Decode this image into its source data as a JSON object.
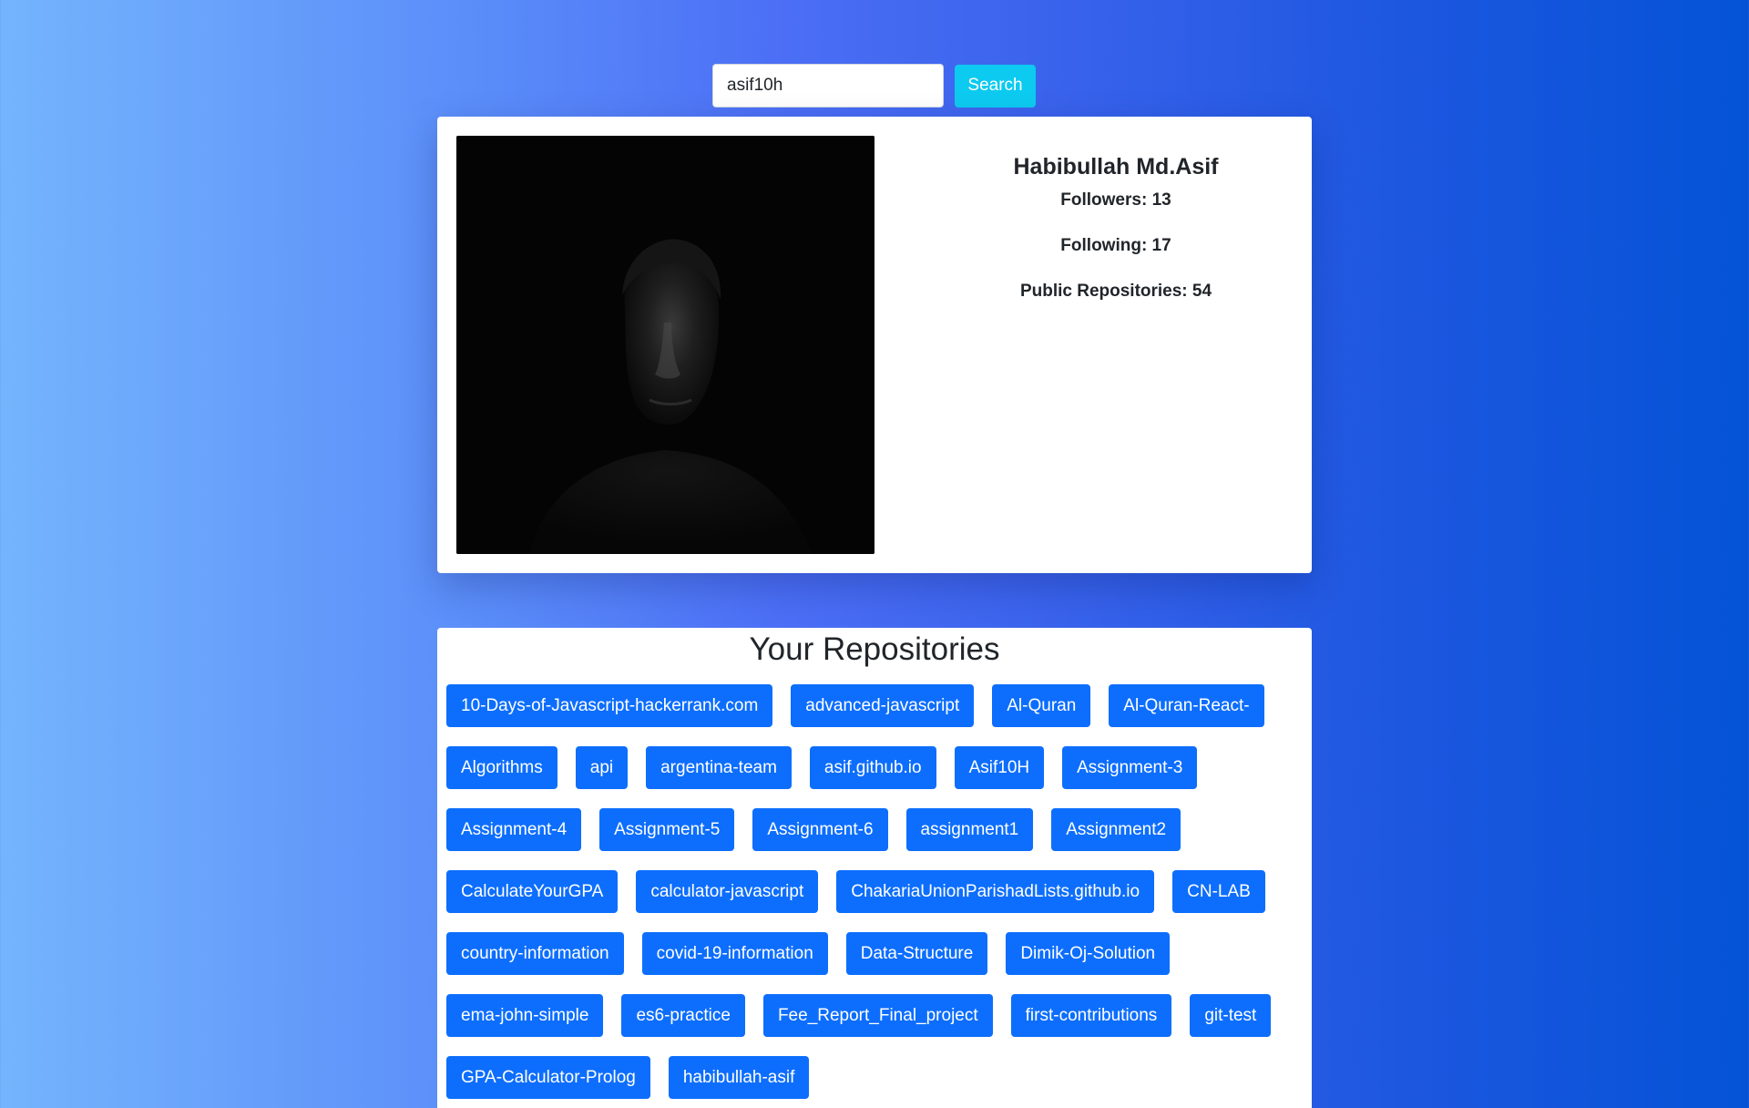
{
  "search": {
    "value": "asif10h",
    "button_label": "Search"
  },
  "profile": {
    "name": "Habibullah Md.Asif",
    "followers_label": "Followers: 13",
    "following_label": "Following: 17",
    "public_repos_label": "Public Repositories: 54"
  },
  "repositories": {
    "title": "Your Repositories",
    "items": [
      "10-Days-of-Javascript-hackerrank.com",
      "advanced-javascript",
      "Al-Quran",
      "Al-Quran-React-",
      "Algorithms",
      "api",
      "argentina-team",
      "asif.github.io",
      "Asif10H",
      "Assignment-3",
      "Assignment-4",
      "Assignment-5",
      "Assignment-6",
      "assignment1",
      "Assignment2",
      "CalculateYourGPA",
      "calculator-javascript",
      "ChakariaUnionParishadLists.github.io",
      "CN-LAB",
      "country-information",
      "covid-19-information",
      "Data-Structure",
      "Dimik-Oj-Solution",
      "ema-john-simple",
      "es6-practice",
      "Fee_Report_Final_project",
      "first-contributions",
      "git-test",
      "GPA-Calculator-Prolog",
      "habibullah-asif"
    ]
  },
  "colors": {
    "search_button": "#0dcaf0",
    "repo_button": "#0d6efd"
  }
}
